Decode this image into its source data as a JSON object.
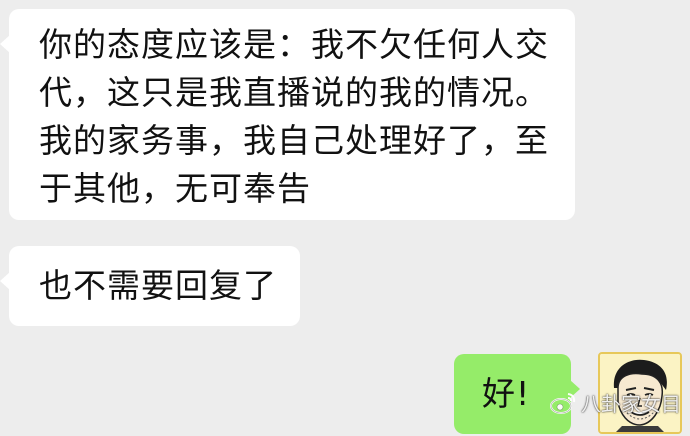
{
  "messages": [
    {
      "side": "left",
      "lines": [
        "你的态度应该是：我不欠任何人交",
        "代，这只是我直播说的我的情况。",
        "我的家务事，我自己处理好了，至",
        "于其他，无可奉告"
      ]
    },
    {
      "side": "left",
      "text": "也不需要回复了"
    },
    {
      "side": "right",
      "text": "好!"
    }
  ],
  "watermark": {
    "icon": "weibo-icon",
    "text": "八卦家女目"
  },
  "colors": {
    "background": "#ededed",
    "incoming_bubble": "#ffffff",
    "outgoing_bubble": "#95ec69"
  }
}
